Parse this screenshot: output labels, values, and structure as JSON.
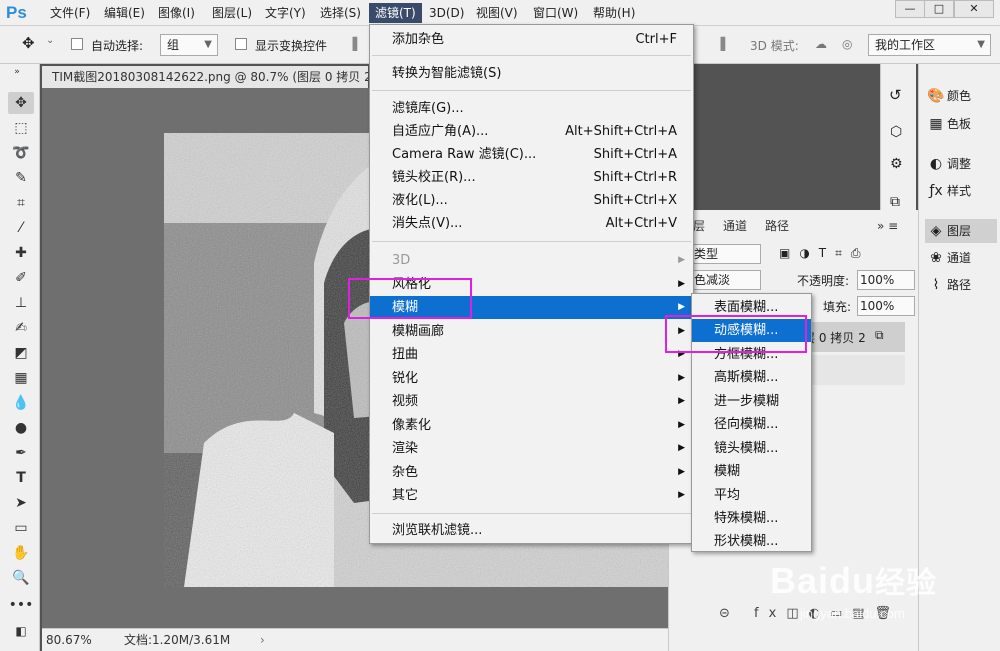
{
  "app": {
    "logo": "Ps"
  },
  "menubar": {
    "items": [
      "文件(F)",
      "编辑(E)",
      "图像(I)",
      "图层(L)",
      "文字(Y)",
      "选择(S)",
      "滤镜(T)",
      "3D(D)",
      "视图(V)",
      "窗口(W)",
      "帮助(H)"
    ],
    "active_index": 6,
    "window_buttons": [
      "—",
      "□",
      "✕"
    ]
  },
  "options": {
    "auto_select_label": "自动选择:",
    "auto_select_value": "组",
    "show_transform_label": "显示变换控件",
    "mode_label": "3D 模式:",
    "workspace": "我的工作区"
  },
  "document": {
    "tab_title": "TIM截图20180308142622.png @ 80.7% (图层 0 拷贝 2",
    "zoom": "80.67%",
    "doc_info": "文档:1.20M/3.61M"
  },
  "filter_menu": {
    "items": [
      {
        "label": "添加杂色",
        "shortcut": "Ctrl+F"
      },
      {
        "label": "转换为智能滤镜(S)",
        "shortcut": ""
      },
      {
        "label": "滤镜库(G)...",
        "shortcut": ""
      },
      {
        "label": "自适应广角(A)...",
        "shortcut": "Alt+Shift+Ctrl+A"
      },
      {
        "label": "Camera Raw 滤镜(C)...",
        "shortcut": "Shift+Ctrl+A"
      },
      {
        "label": "镜头校正(R)...",
        "shortcut": "Shift+Ctrl+R"
      },
      {
        "label": "液化(L)...",
        "shortcut": "Shift+Ctrl+X"
      },
      {
        "label": "消失点(V)...",
        "shortcut": "Alt+Ctrl+V"
      },
      {
        "label": "3D",
        "shortcut": ""
      },
      {
        "label": "风格化",
        "shortcut": ""
      },
      {
        "label": "模糊",
        "shortcut": ""
      },
      {
        "label": "模糊画廊",
        "shortcut": ""
      },
      {
        "label": "扭曲",
        "shortcut": ""
      },
      {
        "label": "锐化",
        "shortcut": ""
      },
      {
        "label": "视频",
        "shortcut": ""
      },
      {
        "label": "像素化",
        "shortcut": ""
      },
      {
        "label": "渲染",
        "shortcut": ""
      },
      {
        "label": "杂色",
        "shortcut": ""
      },
      {
        "label": "其它",
        "shortcut": ""
      },
      {
        "label": "浏览联机滤镜...",
        "shortcut": ""
      }
    ]
  },
  "blur_submenu": {
    "items": [
      "表面模糊...",
      "动感模糊...",
      "方框模糊...",
      "高斯模糊...",
      "进一步模糊",
      "径向模糊...",
      "镜头模糊...",
      "模糊",
      "平均",
      "特殊模糊...",
      "形状模糊..."
    ]
  },
  "layers_panel": {
    "tabs": [
      "层",
      "通道",
      "路径"
    ],
    "filter_label": "类型",
    "blend_mode": "色减淡",
    "opacity_label": "不透明度:",
    "opacity_value": "100%",
    "fill_label": "填充:",
    "fill_value": "100%",
    "layer_name": "层 0 拷贝 2",
    "footer_fx": "fx"
  },
  "right_panel": {
    "items": [
      "颜色",
      "色板",
      "调整",
      "样式",
      "图层",
      "通道",
      "路径"
    ],
    "selected_index": 4
  },
  "watermark": {
    "brand": "Baidu",
    "suffix": "经验",
    "url": "jingyan.baidu.com"
  }
}
